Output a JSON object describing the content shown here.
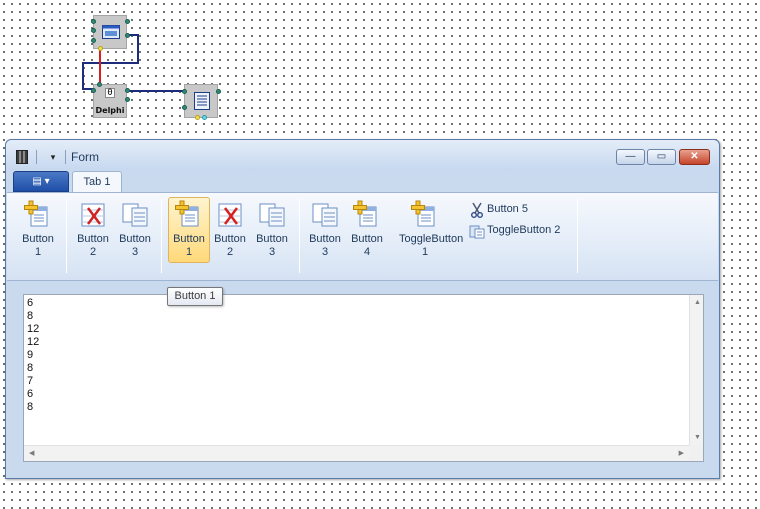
{
  "design": {
    "components": [
      {
        "name": "form-component",
        "label": ""
      },
      {
        "name": "delphi-component",
        "label": "Delphi",
        "number": "0"
      },
      {
        "name": "memo-component",
        "label": ""
      }
    ]
  },
  "window": {
    "title": "Form",
    "minimize_label": "—",
    "maximize_label": "▭",
    "close_label": "✕"
  },
  "ribbon": {
    "app_button_label": "▤ ▾",
    "tab_label": "Tab 1",
    "group1": [
      {
        "line1": "Button",
        "line2": "1",
        "icon": "add-doc-icon"
      }
    ],
    "group2": [
      {
        "line1": "Button",
        "line2": "2",
        "icon": "delete-doc-icon"
      },
      {
        "line1": "Button",
        "line2": "3",
        "icon": "copy-doc-icon"
      }
    ],
    "group3": [
      {
        "line1": "Button",
        "line2": "1",
        "icon": "add-doc-icon"
      },
      {
        "line1": "Button",
        "line2": "2",
        "icon": "delete-doc-icon"
      },
      {
        "line1": "Button",
        "line2": "3",
        "icon": "copy-doc-icon"
      }
    ],
    "group4": [
      {
        "line1": "Button",
        "line2": "3",
        "icon": "copy-doc-icon"
      },
      {
        "line1": "Button",
        "line2": "4",
        "icon": "add-doc-icon"
      },
      {
        "line1": "ToggleButton",
        "line2": "1",
        "icon": "add-doc-icon"
      }
    ],
    "small": [
      {
        "label": "Button 5",
        "icon": "scissors-icon"
      },
      {
        "label": "ToggleButton 2",
        "icon": "paste-icon"
      }
    ]
  },
  "tooltip": "Button 1",
  "memo": {
    "lines": "6\n8\n12\n12\n9\n8\n7\n6\n8"
  },
  "colors": {
    "accent": "#1e4fa7",
    "hover": "#ffd97a",
    "wire": "#1d2c7a",
    "wire_red": "#d42020"
  }
}
